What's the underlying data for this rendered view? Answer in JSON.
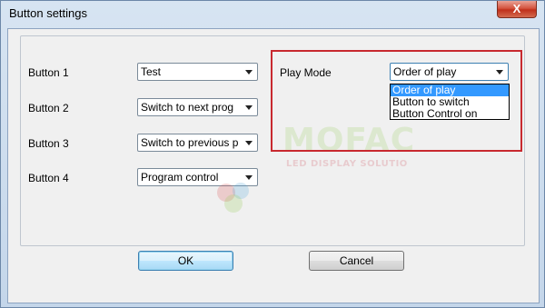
{
  "window": {
    "title": "Button settings",
    "close_glyph": "X"
  },
  "buttons": [
    {
      "label": "Button 1",
      "value": "Test"
    },
    {
      "label": "Button 2",
      "value": "Switch to next prog"
    },
    {
      "label": "Button 3",
      "value": "Switch to previous p"
    },
    {
      "label": "Button 4",
      "value": "Program control"
    }
  ],
  "play_mode": {
    "label": "Play Mode",
    "value": "Order of play",
    "options": [
      "Order of play",
      "Button to switch",
      "Button Control on"
    ],
    "highlight_color": "#c8292f"
  },
  "watermark": {
    "text": "MOFAC",
    "subtext": "LED DISPLAY SOLUTIO"
  },
  "actions": {
    "ok_label": "OK",
    "cancel_label": "Cancel"
  },
  "colors": {
    "selection": "#3399ff",
    "close_button": "#c0301b"
  }
}
